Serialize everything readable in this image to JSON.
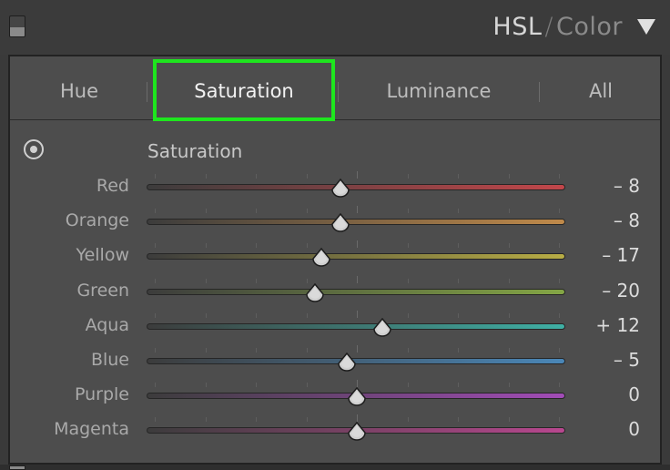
{
  "panel": {
    "title_main": "HSL",
    "title_separator": "/",
    "title_secondary": "Color",
    "collapse_icon": "triangle-down-icon"
  },
  "tabs": [
    {
      "label": "Hue",
      "active": false
    },
    {
      "label": "Saturation",
      "active": true
    },
    {
      "label": "Luminance",
      "active": false
    },
    {
      "label": "All",
      "active": false
    }
  ],
  "section": {
    "label": "Saturation",
    "tool_icon": "target-adjustment-icon"
  },
  "slider_range": [
    -100,
    100
  ],
  "sliders": [
    {
      "label": "Red",
      "value": -8,
      "display": "– 8",
      "start_color": "#3c3c3c",
      "end_color": "#c2464a"
    },
    {
      "label": "Orange",
      "value": -8,
      "display": "– 8",
      "start_color": "#3c3c3c",
      "end_color": "#c08a4a"
    },
    {
      "label": "Yellow",
      "value": -17,
      "display": "– 17",
      "start_color": "#3c3c3c",
      "end_color": "#b8ad45"
    },
    {
      "label": "Green",
      "value": -20,
      "display": "– 20",
      "start_color": "#3c3c3c",
      "end_color": "#84a645"
    },
    {
      "label": "Aqua",
      "value": 12,
      "display": "+ 12",
      "start_color": "#3c3c3c",
      "end_color": "#3fb0a5"
    },
    {
      "label": "Blue",
      "value": -5,
      "display": "– 5",
      "start_color": "#3c3c3c",
      "end_color": "#4a87b8"
    },
    {
      "label": "Purple",
      "value": 0,
      "display": "0",
      "start_color": "#3c3c3c",
      "end_color": "#a24cb7"
    },
    {
      "label": "Magenta",
      "value": 0,
      "display": "0",
      "start_color": "#3c3c3c",
      "end_color": "#b8478f"
    }
  ],
  "colors": {
    "highlight": "#1ee61e"
  }
}
